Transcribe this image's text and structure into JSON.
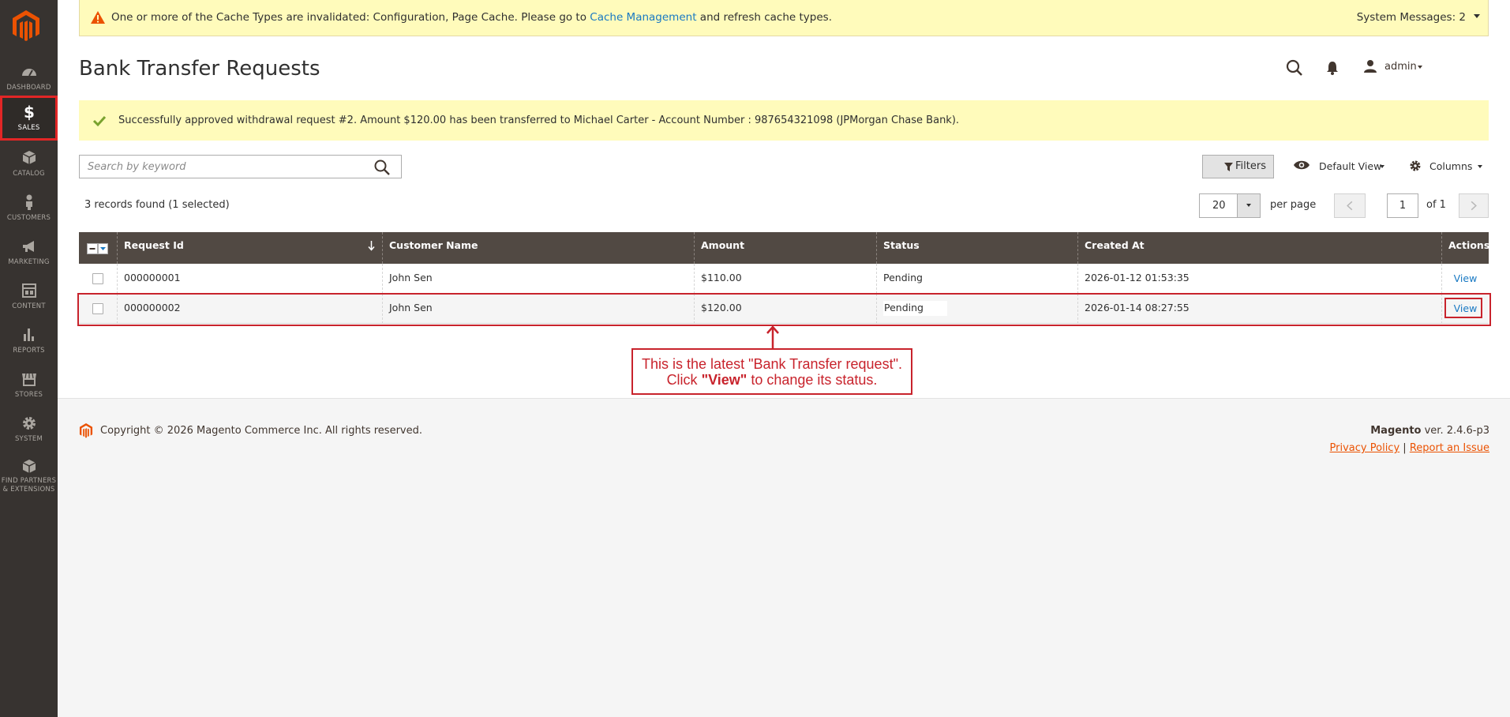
{
  "colors": {
    "sidebar_bg": "#373330",
    "accent": "#eb5202",
    "link": "#1979c3",
    "grid_header": "#514943",
    "message_bg": "#fffbbb",
    "annotation": "#c8232c"
  },
  "sidebar": {
    "items": [
      {
        "label": "DASHBOARD",
        "icon": "dashboard-icon"
      },
      {
        "label": "SALES",
        "icon": "dollar-icon",
        "active": true
      },
      {
        "label": "CATALOG",
        "icon": "cube-icon"
      },
      {
        "label": "CUSTOMERS",
        "icon": "person-icon"
      },
      {
        "label": "MARKETING",
        "icon": "megaphone-icon"
      },
      {
        "label": "CONTENT",
        "icon": "layout-icon"
      },
      {
        "label": "REPORTS",
        "icon": "bar-chart-icon"
      },
      {
        "label": "STORES",
        "icon": "store-icon"
      },
      {
        "label": "SYSTEM",
        "icon": "gear-icon"
      },
      {
        "label": "FIND PARTNERS",
        "label2": "& EXTENSIONS",
        "icon": "box-icon"
      }
    ]
  },
  "system_message": {
    "text_before": "One or more of the Cache Types are invalidated: Configuration, Page Cache. Please go to ",
    "link_text": "Cache Management",
    "text_after": " and refresh cache types.",
    "count_label": "System Messages: 2"
  },
  "header": {
    "title": "Bank Transfer Requests",
    "user_name": "admin"
  },
  "success_message": "Successfully approved withdrawal request #2. Amount $120.00 has been transferred to Michael Carter - Account Number : 987654321098 (JPMorgan Chase Bank).",
  "toolbar": {
    "search_placeholder": "Search by keyword",
    "filters_label": "Filters",
    "view_label": "Default View",
    "columns_label": "Columns",
    "records_found": "3 records found (1 selected)",
    "per_page_value": "20",
    "per_page_label": "per page",
    "page_value": "1",
    "page_of": "of 1"
  },
  "grid": {
    "columns": [
      "Request Id",
      "Customer Name",
      "Amount",
      "Status",
      "Created At",
      "Actions"
    ],
    "rows": [
      {
        "id": "000000001",
        "customer": "John Sen",
        "amount": "$110.00",
        "status": "Pending",
        "created": "2026-01-12 01:53:35",
        "action": "View"
      },
      {
        "id": "000000002",
        "customer": "John Sen",
        "amount": "$120.00",
        "status": "Pending",
        "created": "2026-01-14 08:27:55",
        "action": "View"
      }
    ]
  },
  "annotation": {
    "line1": "This is the latest \"Bank Transfer request\".",
    "line2_before": "Click ",
    "line2_bold": "\"View\"",
    "line2_after": " to change its status."
  },
  "footer": {
    "copyright": "Copyright © 2026 Magento Commerce Inc. All rights reserved.",
    "brand": "Magento",
    "version": " ver. 2.4.6-p3",
    "privacy": "Privacy Policy",
    "separator": " | ",
    "report": "Report an Issue"
  }
}
